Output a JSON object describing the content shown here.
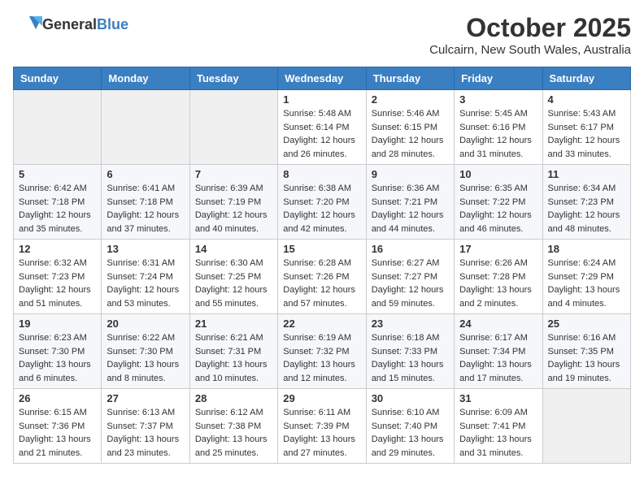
{
  "logo": {
    "general": "General",
    "blue": "Blue"
  },
  "header": {
    "month": "October 2025",
    "location": "Culcairn, New South Wales, Australia"
  },
  "weekdays": [
    "Sunday",
    "Monday",
    "Tuesday",
    "Wednesday",
    "Thursday",
    "Friday",
    "Saturday"
  ],
  "weeks": [
    [
      {
        "day": "",
        "info": ""
      },
      {
        "day": "",
        "info": ""
      },
      {
        "day": "",
        "info": ""
      },
      {
        "day": "1",
        "info": "Sunrise: 5:48 AM\nSunset: 6:14 PM\nDaylight: 12 hours\nand 26 minutes."
      },
      {
        "day": "2",
        "info": "Sunrise: 5:46 AM\nSunset: 6:15 PM\nDaylight: 12 hours\nand 28 minutes."
      },
      {
        "day": "3",
        "info": "Sunrise: 5:45 AM\nSunset: 6:16 PM\nDaylight: 12 hours\nand 31 minutes."
      },
      {
        "day": "4",
        "info": "Sunrise: 5:43 AM\nSunset: 6:17 PM\nDaylight: 12 hours\nand 33 minutes."
      }
    ],
    [
      {
        "day": "5",
        "info": "Sunrise: 6:42 AM\nSunset: 7:18 PM\nDaylight: 12 hours\nand 35 minutes."
      },
      {
        "day": "6",
        "info": "Sunrise: 6:41 AM\nSunset: 7:18 PM\nDaylight: 12 hours\nand 37 minutes."
      },
      {
        "day": "7",
        "info": "Sunrise: 6:39 AM\nSunset: 7:19 PM\nDaylight: 12 hours\nand 40 minutes."
      },
      {
        "day": "8",
        "info": "Sunrise: 6:38 AM\nSunset: 7:20 PM\nDaylight: 12 hours\nand 42 minutes."
      },
      {
        "day": "9",
        "info": "Sunrise: 6:36 AM\nSunset: 7:21 PM\nDaylight: 12 hours\nand 44 minutes."
      },
      {
        "day": "10",
        "info": "Sunrise: 6:35 AM\nSunset: 7:22 PM\nDaylight: 12 hours\nand 46 minutes."
      },
      {
        "day": "11",
        "info": "Sunrise: 6:34 AM\nSunset: 7:23 PM\nDaylight: 12 hours\nand 48 minutes."
      }
    ],
    [
      {
        "day": "12",
        "info": "Sunrise: 6:32 AM\nSunset: 7:23 PM\nDaylight: 12 hours\nand 51 minutes."
      },
      {
        "day": "13",
        "info": "Sunrise: 6:31 AM\nSunset: 7:24 PM\nDaylight: 12 hours\nand 53 minutes."
      },
      {
        "day": "14",
        "info": "Sunrise: 6:30 AM\nSunset: 7:25 PM\nDaylight: 12 hours\nand 55 minutes."
      },
      {
        "day": "15",
        "info": "Sunrise: 6:28 AM\nSunset: 7:26 PM\nDaylight: 12 hours\nand 57 minutes."
      },
      {
        "day": "16",
        "info": "Sunrise: 6:27 AM\nSunset: 7:27 PM\nDaylight: 12 hours\nand 59 minutes."
      },
      {
        "day": "17",
        "info": "Sunrise: 6:26 AM\nSunset: 7:28 PM\nDaylight: 13 hours\nand 2 minutes."
      },
      {
        "day": "18",
        "info": "Sunrise: 6:24 AM\nSunset: 7:29 PM\nDaylight: 13 hours\nand 4 minutes."
      }
    ],
    [
      {
        "day": "19",
        "info": "Sunrise: 6:23 AM\nSunset: 7:30 PM\nDaylight: 13 hours\nand 6 minutes."
      },
      {
        "day": "20",
        "info": "Sunrise: 6:22 AM\nSunset: 7:30 PM\nDaylight: 13 hours\nand 8 minutes."
      },
      {
        "day": "21",
        "info": "Sunrise: 6:21 AM\nSunset: 7:31 PM\nDaylight: 13 hours\nand 10 minutes."
      },
      {
        "day": "22",
        "info": "Sunrise: 6:19 AM\nSunset: 7:32 PM\nDaylight: 13 hours\nand 12 minutes."
      },
      {
        "day": "23",
        "info": "Sunrise: 6:18 AM\nSunset: 7:33 PM\nDaylight: 13 hours\nand 15 minutes."
      },
      {
        "day": "24",
        "info": "Sunrise: 6:17 AM\nSunset: 7:34 PM\nDaylight: 13 hours\nand 17 minutes."
      },
      {
        "day": "25",
        "info": "Sunrise: 6:16 AM\nSunset: 7:35 PM\nDaylight: 13 hours\nand 19 minutes."
      }
    ],
    [
      {
        "day": "26",
        "info": "Sunrise: 6:15 AM\nSunset: 7:36 PM\nDaylight: 13 hours\nand 21 minutes."
      },
      {
        "day": "27",
        "info": "Sunrise: 6:13 AM\nSunset: 7:37 PM\nDaylight: 13 hours\nand 23 minutes."
      },
      {
        "day": "28",
        "info": "Sunrise: 6:12 AM\nSunset: 7:38 PM\nDaylight: 13 hours\nand 25 minutes."
      },
      {
        "day": "29",
        "info": "Sunrise: 6:11 AM\nSunset: 7:39 PM\nDaylight: 13 hours\nand 27 minutes."
      },
      {
        "day": "30",
        "info": "Sunrise: 6:10 AM\nSunset: 7:40 PM\nDaylight: 13 hours\nand 29 minutes."
      },
      {
        "day": "31",
        "info": "Sunrise: 6:09 AM\nSunset: 7:41 PM\nDaylight: 13 hours\nand 31 minutes."
      },
      {
        "day": "",
        "info": ""
      }
    ]
  ]
}
